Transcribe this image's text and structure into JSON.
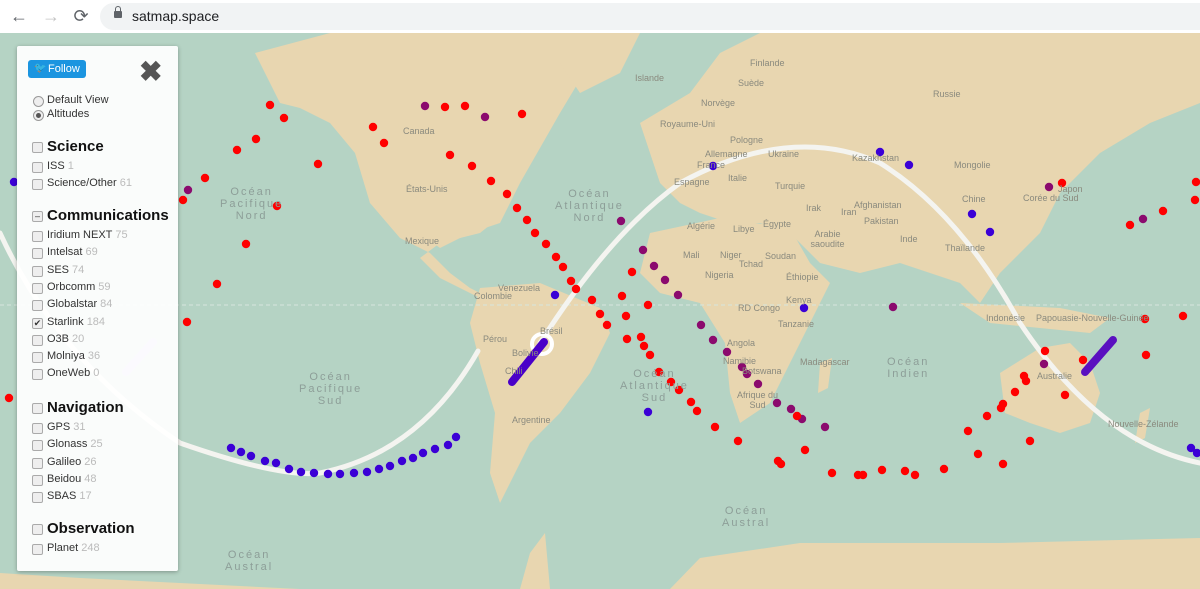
{
  "browser": {
    "url": "satmap.space",
    "back_icon": "←",
    "forward_icon": "→",
    "reload_icon": "⟳"
  },
  "panel": {
    "follow_label": "Follow",
    "close_icon": "✖",
    "views": [
      {
        "label": "Default View",
        "selected": false
      },
      {
        "label": "Altitudes",
        "selected": true
      }
    ],
    "groups": [
      {
        "title": "Science",
        "state": "unchecked",
        "items": [
          {
            "label": "ISS",
            "count": "1",
            "checked": false
          },
          {
            "label": "Science/Other",
            "count": "61",
            "checked": false
          }
        ]
      },
      {
        "title": "Communications",
        "state": "indeterminate",
        "items": [
          {
            "label": "Iridium NEXT",
            "count": "75",
            "checked": false
          },
          {
            "label": "Intelsat",
            "count": "69",
            "checked": false
          },
          {
            "label": "SES",
            "count": "74",
            "checked": false
          },
          {
            "label": "Orbcomm",
            "count": "59",
            "checked": false
          },
          {
            "label": "Globalstar",
            "count": "84",
            "checked": false
          },
          {
            "label": "Starlink",
            "count": "184",
            "checked": true
          },
          {
            "label": "O3B",
            "count": "20",
            "checked": false
          },
          {
            "label": "Molniya",
            "count": "36",
            "checked": false
          },
          {
            "label": "OneWeb",
            "count": "0",
            "checked": false
          }
        ]
      },
      {
        "title": "Navigation",
        "state": "unchecked",
        "items": [
          {
            "label": "GPS",
            "count": "31",
            "checked": false
          },
          {
            "label": "Glonass",
            "count": "25",
            "checked": false
          },
          {
            "label": "Galileo",
            "count": "26",
            "checked": false
          },
          {
            "label": "Beidou",
            "count": "48",
            "checked": false
          },
          {
            "label": "SBAS",
            "count": "17",
            "checked": false
          }
        ]
      },
      {
        "title": "Observation",
        "state": "unchecked",
        "items": [
          {
            "label": "Planet",
            "count": "248",
            "checked": false
          }
        ]
      }
    ]
  },
  "map": {
    "colors": {
      "ocean": "#b5d3c4",
      "land": "#e8d6b0",
      "sat_low": "#ff0000",
      "sat_mid": "#8b0a6e",
      "sat_high": "#3b00d6",
      "track": "#f4f4f0"
    },
    "countries": [
      "Canada",
      "États-Unis",
      "Mexique",
      "Venezuela",
      "Colombie",
      "Pérou",
      "Brésil",
      "Bolivie",
      "Chili",
      "Argentine",
      "Islande",
      "Finlande",
      "Suède",
      "Norvège",
      "Royaume-Uni",
      "Pologne",
      "Allemagne",
      "France",
      "Espagne",
      "Italie",
      "Ukraine",
      "Russie",
      "Kazakhstan",
      "Mongolie",
      "Chine",
      "Japon",
      "Corée du Sud",
      "Turquie",
      "Irak",
      "Iran",
      "Afghanistan",
      "Pakistan",
      "Inde",
      "Thaïlande",
      "Arabie saoudite",
      "Algérie",
      "Libye",
      "Égypte",
      "Mali",
      "Niger",
      "Tchad",
      "Soudan",
      "Nigeria",
      "Éthiopie",
      "Kenya",
      "RD Congo",
      "Tanzanie",
      "Angola",
      "Namibie",
      "Botswana",
      "Madagascar",
      "Afrique du Sud",
      "Indonésie",
      "Papouasie-Nouvelle-Guinée",
      "Australie",
      "Nouvelle-Zélande"
    ],
    "oceans": [
      "Océan\nPacifique\nNord",
      "Océan\nAtlantique\nNord",
      "Océan\nPacifique\nSud",
      "Océan\nAtlantique\nSud",
      "Océan\nIndien",
      "Océan\nAustral",
      "Océan\nAustral"
    ]
  }
}
